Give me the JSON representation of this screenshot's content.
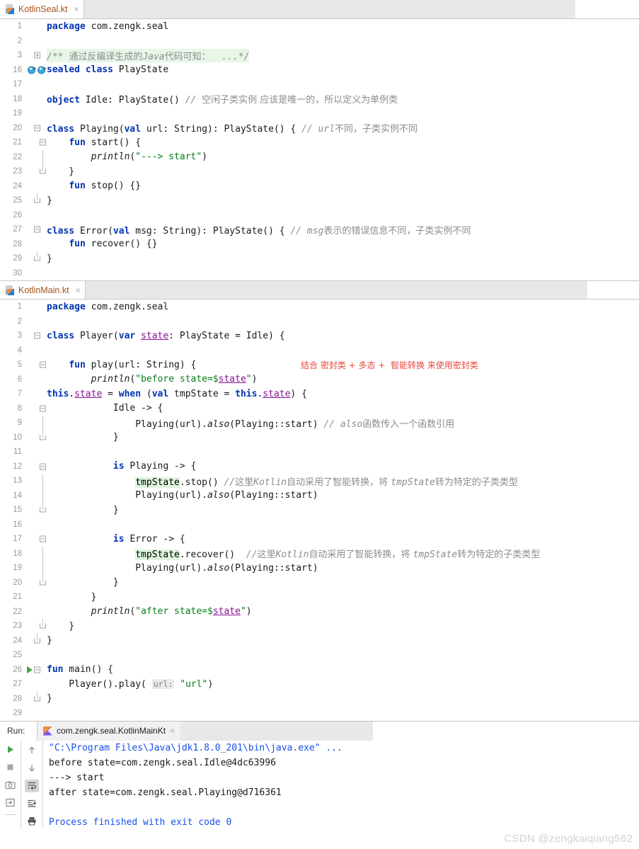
{
  "editors": [
    {
      "tab": {
        "filename": "KotlinSeal.kt",
        "icon": "kotlin-file-icon",
        "close": "×"
      },
      "tab_strip_width": 815,
      "lines": [
        {
          "num": "1",
          "fold": "",
          "segments": [
            {
              "t": "kw",
              "v": "package"
            },
            {
              "t": "ident",
              "v": " com.zengk.seal"
            }
          ]
        },
        {
          "num": "2",
          "fold": "",
          "segments": []
        },
        {
          "num": "3",
          "fold": "plus",
          "highlight": "green",
          "segments": [
            {
              "t": "cmt",
              "v": "/** "
            },
            {
              "t": "cmt-cn",
              "v": "通过反编译生成的"
            },
            {
              "t": "cmt",
              "v": "Java"
            },
            {
              "t": "cmt-cn",
              "v": "代码可知："
            },
            {
              "t": "cmt",
              "v": "  ...*/"
            }
          ]
        },
        {
          "num": "16",
          "fold": "",
          "marker": "implemented-by",
          "segments": [
            {
              "t": "kw",
              "v": "sealed class"
            },
            {
              "t": "ident",
              "v": " PlayState"
            }
          ]
        },
        {
          "num": "17",
          "fold": "",
          "segments": []
        },
        {
          "num": "18",
          "fold": "",
          "segments": [
            {
              "t": "kw",
              "v": "object"
            },
            {
              "t": "ident",
              "v": " Idle: PlayState() "
            },
            {
              "t": "cmt",
              "v": "// "
            },
            {
              "t": "cmt-cn",
              "v": "空闲子类实例 应该是唯一的，所以定义为单例类"
            }
          ]
        },
        {
          "num": "19",
          "fold": "",
          "segments": []
        },
        {
          "num": "20",
          "fold": "top",
          "segments": [
            {
              "t": "kw",
              "v": "class"
            },
            {
              "t": "ident",
              "v": " Playing("
            },
            {
              "t": "kw",
              "v": "val"
            },
            {
              "t": "ident",
              "v": " url: String): PlayState() { "
            },
            {
              "t": "cmt",
              "v": "// url"
            },
            {
              "t": "cmt-cn",
              "v": "不同，子类实例不同"
            }
          ]
        },
        {
          "num": "21",
          "fold": "top2",
          "segments": [
            {
              "t": "ident",
              "v": "    "
            },
            {
              "t": "kw",
              "v": "fun"
            },
            {
              "t": "ident",
              "v": " start() {"
            }
          ]
        },
        {
          "num": "22",
          "fold": "line2",
          "segments": [
            {
              "t": "ident",
              "v": "        "
            },
            {
              "t": "fn",
              "v": "println"
            },
            {
              "t": "ident",
              "v": "("
            },
            {
              "t": "str",
              "v": "\"---> start\""
            },
            {
              "t": "ident",
              "v": ")"
            }
          ]
        },
        {
          "num": "23",
          "fold": "bottom2",
          "segments": [
            {
              "t": "ident",
              "v": "    }"
            }
          ]
        },
        {
          "num": "24",
          "fold": "",
          "segments": [
            {
              "t": "ident",
              "v": "    "
            },
            {
              "t": "kw",
              "v": "fun"
            },
            {
              "t": "ident",
              "v": " stop() {}"
            }
          ]
        },
        {
          "num": "25",
          "fold": "bottom",
          "segments": [
            {
              "t": "ident",
              "v": "}"
            }
          ]
        },
        {
          "num": "26",
          "fold": "",
          "segments": []
        },
        {
          "num": "27",
          "fold": "top",
          "segments": [
            {
              "t": "kw",
              "v": "class"
            },
            {
              "t": "ident",
              "v": " Error("
            },
            {
              "t": "kw",
              "v": "val"
            },
            {
              "t": "ident",
              "v": " msg: String): PlayState() { "
            },
            {
              "t": "cmt",
              "v": "// msg"
            },
            {
              "t": "cmt-cn",
              "v": "表示的错误信息不同，子类实例不同"
            }
          ]
        },
        {
          "num": "28",
          "fold": "",
          "segments": [
            {
              "t": "ident",
              "v": "    "
            },
            {
              "t": "kw",
              "v": "fun"
            },
            {
              "t": "ident",
              "v": " recover() {}"
            }
          ]
        },
        {
          "num": "29",
          "fold": "bottom",
          "segments": [
            {
              "t": "ident",
              "v": "}"
            }
          ]
        },
        {
          "num": "30",
          "fold": "",
          "segments": []
        }
      ]
    },
    {
      "tab": {
        "filename": "KotlinMain.kt",
        "icon": "kotlin-file-icon",
        "close": "×"
      },
      "tab_strip_width": 840,
      "lines": [
        {
          "num": "1",
          "fold": "",
          "segments": [
            {
              "t": "kw",
              "v": "package"
            },
            {
              "t": "ident",
              "v": " com.zengk.seal"
            }
          ]
        },
        {
          "num": "2",
          "fold": "",
          "segments": []
        },
        {
          "num": "3",
          "fold": "top",
          "segments": [
            {
              "t": "kw",
              "v": "class"
            },
            {
              "t": "ident",
              "v": " Player("
            },
            {
              "t": "kw",
              "v": "var"
            },
            {
              "t": "ident",
              "v": " "
            },
            {
              "t": "field",
              "v": "state"
            },
            {
              "t": "ident",
              "v": ": PlayState = Idle) {"
            }
          ]
        },
        {
          "num": "4",
          "fold": "",
          "segments": []
        },
        {
          "num": "5",
          "fold": "top2",
          "annot": "结合 密封类 + 多态 +  智能转换 来使用密封类",
          "segments": [
            {
              "t": "ident",
              "v": "    "
            },
            {
              "t": "kw",
              "v": "fun"
            },
            {
              "t": "ident",
              "v": " play(url: String) {"
            }
          ]
        },
        {
          "num": "6",
          "fold": "",
          "segments": [
            {
              "t": "ident",
              "v": "        "
            },
            {
              "t": "fn",
              "v": "println"
            },
            {
              "t": "ident",
              "v": "("
            },
            {
              "t": "str",
              "v": "\"before state="
            },
            {
              "t": "tmplf",
              "v": "$state"
            },
            {
              "t": "str",
              "v": "\""
            },
            {
              "t": "ident",
              "v": ")"
            }
          ]
        },
        {
          "num": "7",
          "fold": "",
          "segments": [
            {
              "t": "kw",
              "v": "this"
            },
            {
              "t": "ident",
              "v": "."
            },
            {
              "t": "field",
              "v": "state"
            },
            {
              "t": "ident",
              "v": " = "
            },
            {
              "t": "kw",
              "v": "when"
            },
            {
              "t": "ident",
              "v": " ("
            },
            {
              "t": "kw",
              "v": "val"
            },
            {
              "t": "ident",
              "v": " tmpState = "
            },
            {
              "t": "kw",
              "v": "this"
            },
            {
              "t": "ident",
              "v": "."
            },
            {
              "t": "field",
              "v": "state"
            },
            {
              "t": "ident",
              "v": ") {"
            }
          ]
        },
        {
          "num": "8",
          "fold": "top3",
          "segments": [
            {
              "t": "ident",
              "v": "            Idle -> {"
            }
          ]
        },
        {
          "num": "9",
          "fold": "line3",
          "segments": [
            {
              "t": "ident",
              "v": "                Playing(url)."
            },
            {
              "t": "fn",
              "v": "also"
            },
            {
              "t": "ident",
              "v": "(Playing::start) "
            },
            {
              "t": "cmt",
              "v": "// also"
            },
            {
              "t": "cmt-cn",
              "v": "函数传入一个函数引用"
            }
          ]
        },
        {
          "num": "10",
          "fold": "bottom3",
          "segments": [
            {
              "t": "ident",
              "v": "            }"
            }
          ]
        },
        {
          "num": "11",
          "fold": "",
          "segments": []
        },
        {
          "num": "12",
          "fold": "top3",
          "segments": [
            {
              "t": "ident",
              "v": "            "
            },
            {
              "t": "kw",
              "v": "is"
            },
            {
              "t": "ident",
              "v": " Playing -> {"
            }
          ]
        },
        {
          "num": "13",
          "fold": "line3",
          "segments": [
            {
              "t": "ident",
              "v": "                "
            },
            {
              "t": "hl",
              "v": "tmpState"
            },
            {
              "t": "ident",
              "v": ".stop() "
            },
            {
              "t": "cmt",
              "v": "//"
            },
            {
              "t": "cmt-cn",
              "v": "这里"
            },
            {
              "t": "cmt",
              "v": "Kotlin"
            },
            {
              "t": "cmt-cn",
              "v": "自动采用了智能转换，将 "
            },
            {
              "t": "cmt",
              "v": "tmpState"
            },
            {
              "t": "cmt-cn",
              "v": "转为特定的子类类型"
            }
          ]
        },
        {
          "num": "14",
          "fold": "line3",
          "segments": [
            {
              "t": "ident",
              "v": "                Playing(url)."
            },
            {
              "t": "fn",
              "v": "also"
            },
            {
              "t": "ident",
              "v": "(Playing::start)"
            }
          ]
        },
        {
          "num": "15",
          "fold": "bottom3",
          "segments": [
            {
              "t": "ident",
              "v": "            }"
            }
          ]
        },
        {
          "num": "16",
          "fold": "",
          "segments": []
        },
        {
          "num": "17",
          "fold": "top3",
          "segments": [
            {
              "t": "ident",
              "v": "            "
            },
            {
              "t": "kw",
              "v": "is"
            },
            {
              "t": "ident",
              "v": " Error -> {"
            }
          ]
        },
        {
          "num": "18",
          "fold": "line3",
          "segments": [
            {
              "t": "ident",
              "v": "                "
            },
            {
              "t": "hl",
              "v": "tmpState"
            },
            {
              "t": "ident",
              "v": ".recover()  "
            },
            {
              "t": "cmt",
              "v": "//"
            },
            {
              "t": "cmt-cn",
              "v": "这里"
            },
            {
              "t": "cmt",
              "v": "Kotlin"
            },
            {
              "t": "cmt-cn",
              "v": "自动采用了智能转换，将 "
            },
            {
              "t": "cmt",
              "v": "tmpState"
            },
            {
              "t": "cmt-cn",
              "v": "转为特定的子类类型"
            }
          ]
        },
        {
          "num": "19",
          "fold": "line3",
          "segments": [
            {
              "t": "ident",
              "v": "                Playing(url)."
            },
            {
              "t": "fn",
              "v": "also"
            },
            {
              "t": "ident",
              "v": "(Playing::start)"
            }
          ]
        },
        {
          "num": "20",
          "fold": "bottom3",
          "segments": [
            {
              "t": "ident",
              "v": "            }"
            }
          ]
        },
        {
          "num": "21",
          "fold": "",
          "segments": [
            {
              "t": "ident",
              "v": "        }"
            }
          ]
        },
        {
          "num": "22",
          "fold": "",
          "segments": [
            {
              "t": "ident",
              "v": "        "
            },
            {
              "t": "fn",
              "v": "println"
            },
            {
              "t": "ident",
              "v": "("
            },
            {
              "t": "str",
              "v": "\"after state="
            },
            {
              "t": "tmplf",
              "v": "$state"
            },
            {
              "t": "str",
              "v": "\""
            },
            {
              "t": "ident",
              "v": ")"
            }
          ]
        },
        {
          "num": "23",
          "fold": "bottom2",
          "segments": [
            {
              "t": "ident",
              "v": "    }"
            }
          ]
        },
        {
          "num": "24",
          "fold": "bottom",
          "segments": [
            {
              "t": "ident",
              "v": "}"
            }
          ]
        },
        {
          "num": "25",
          "fold": "",
          "segments": []
        },
        {
          "num": "26",
          "fold": "top",
          "marker": "run-main",
          "segments": [
            {
              "t": "kw",
              "v": "fun"
            },
            {
              "t": "ident",
              "v": " main() {"
            }
          ]
        },
        {
          "num": "27",
          "fold": "",
          "segments": [
            {
              "t": "ident",
              "v": "    Player().play( "
            },
            {
              "t": "chip",
              "v": "url:"
            },
            {
              "t": "ident",
              "v": " "
            },
            {
              "t": "str",
              "v": "\"url\""
            },
            {
              "t": "ident",
              "v": ")"
            }
          ]
        },
        {
          "num": "28",
          "fold": "bottom",
          "segments": [
            {
              "t": "ident",
              "v": "}"
            }
          ]
        },
        {
          "num": "29",
          "fold": "",
          "segments": []
        }
      ]
    }
  ],
  "run_panel": {
    "label": "Run:",
    "tab": {
      "title": "com.zengk.seal.KotlinMainKt",
      "icon": "kotlin-logo-icon",
      "close": "×"
    },
    "toolbar_left": [
      {
        "name": "run-button",
        "glyph": "▶"
      },
      {
        "name": "stop-button",
        "glyph": "■"
      },
      {
        "name": "camera-button",
        "glyph": "camera"
      },
      {
        "name": "rerun-button",
        "glyph": "rerun"
      }
    ],
    "toolbar_right": [
      {
        "name": "up-arrow-button",
        "glyph": "↑"
      },
      {
        "name": "down-arrow-button",
        "glyph": "↓"
      },
      {
        "name": "soft-wrap-button",
        "glyph": "wrap",
        "active": true
      },
      {
        "name": "scroll-to-end-button",
        "glyph": "scrollend"
      },
      {
        "name": "print-button",
        "glyph": "printer"
      }
    ],
    "console": [
      {
        "text": "\"C:\\Program Files\\Java\\jdk1.8.0_201\\bin\\java.exe\" ...",
        "style": "cmd"
      },
      {
        "text": "before state=com.zengk.seal.Idle@4dc63996",
        "style": "out"
      },
      {
        "text": "---> start",
        "style": "out"
      },
      {
        "text": "after state=com.zengk.seal.Playing@d716361",
        "style": "out"
      },
      {
        "text": "",
        "style": "out"
      },
      {
        "text": "Process finished with exit code 0",
        "style": "exit"
      }
    ]
  },
  "watermark": "CSDN @zengkaiqiang562",
  "colors": {
    "keyword": "#0033b3",
    "string": "#067d17",
    "comment": "#8c8c8c",
    "field": "#871094",
    "annotation_red": "#e8483c",
    "console_blue": "#1750eb",
    "run_green": "#45a247"
  }
}
